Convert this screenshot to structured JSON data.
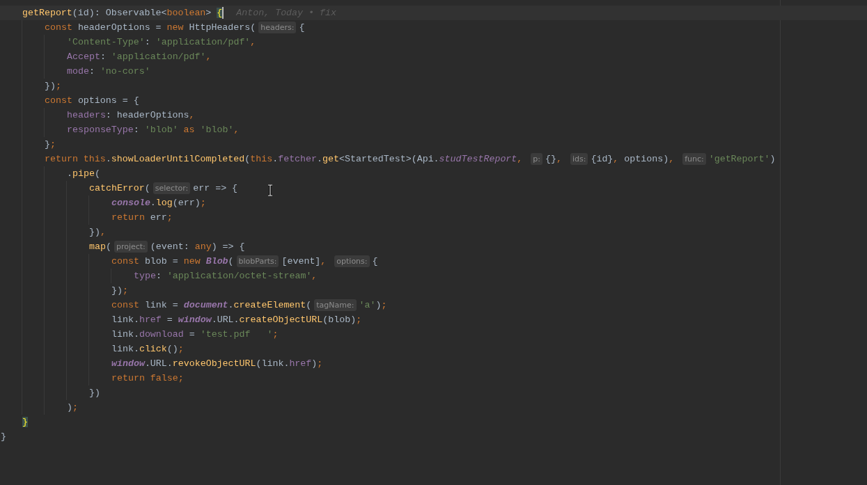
{
  "editor": {
    "lines": [
      {
        "current": true,
        "tokens": [
          {
            "kind": "fn",
            "text": "getReport"
          },
          {
            "kind": "plain",
            "text": "(id): Observable<"
          },
          {
            "kind": "kw",
            "text": "boolean"
          },
          {
            "kind": "plain",
            "text": "> "
          },
          {
            "kind": "match",
            "text": "{"
          },
          {
            "kind": "blame",
            "text": "Anton, Today • fix"
          }
        ],
        "children": [
          {
            "current": false,
            "tokens": [
              {
                "kind": "kw",
                "text": "const "
              },
              {
                "kind": "plain",
                "text": "headerOptions = "
              },
              {
                "kind": "kw",
                "text": "new "
              },
              {
                "kind": "plain",
                "text": "HttpHeaders("
              },
              {
                "kind": "hint",
                "text": "headers:"
              },
              {
                "kind": "plain",
                "text": "{"
              }
            ],
            "children": [
              {
                "current": false,
                "tokens": [
                  {
                    "kind": "str",
                    "text": "'Content-Type'"
                  },
                  {
                    "kind": "plain",
                    "text": ": "
                  },
                  {
                    "kind": "str",
                    "text": "'application/pdf'"
                  },
                  {
                    "kind": "punct",
                    "text": ","
                  }
                ]
              },
              {
                "current": false,
                "tokens": [
                  {
                    "kind": "prop",
                    "text": "Accept"
                  },
                  {
                    "kind": "plain",
                    "text": ": "
                  },
                  {
                    "kind": "str",
                    "text": "'application/pdf'"
                  },
                  {
                    "kind": "punct",
                    "text": ","
                  }
                ]
              },
              {
                "current": false,
                "tokens": [
                  {
                    "kind": "prop",
                    "text": "mode"
                  },
                  {
                    "kind": "plain",
                    "text": ": "
                  },
                  {
                    "kind": "str",
                    "text": "'no-cors'"
                  }
                ]
              }
            ]
          },
          {
            "current": false,
            "tokens": [
              {
                "kind": "plain",
                "text": "})"
              },
              {
                "kind": "punct",
                "text": ";"
              }
            ]
          },
          {
            "current": false,
            "tokens": [
              {
                "kind": "kw",
                "text": "const "
              },
              {
                "kind": "plain",
                "text": "options = {"
              }
            ],
            "children": [
              {
                "current": false,
                "tokens": [
                  {
                    "kind": "prop",
                    "text": "headers"
                  },
                  {
                    "kind": "plain",
                    "text": ": headerOptions"
                  },
                  {
                    "kind": "punct",
                    "text": ","
                  }
                ]
              },
              {
                "current": false,
                "tokens": [
                  {
                    "kind": "prop",
                    "text": "responseType"
                  },
                  {
                    "kind": "plain",
                    "text": ": "
                  },
                  {
                    "kind": "str",
                    "text": "'blob'"
                  },
                  {
                    "kind": "kw",
                    "text": " as "
                  },
                  {
                    "kind": "str",
                    "text": "'blob'"
                  },
                  {
                    "kind": "punct",
                    "text": ","
                  }
                ]
              }
            ]
          },
          {
            "current": false,
            "tokens": [
              {
                "kind": "plain",
                "text": "}"
              },
              {
                "kind": "punct",
                "text": ";"
              }
            ]
          },
          {
            "current": false,
            "tokens": [
              {
                "kind": "kw",
                "text": "return this"
              },
              {
                "kind": "plain",
                "text": "."
              },
              {
                "kind": "fn",
                "text": "showLoaderUntilCompleted"
              },
              {
                "kind": "plain",
                "text": "("
              },
              {
                "kind": "kw",
                "text": "this"
              },
              {
                "kind": "plain",
                "text": "."
              },
              {
                "kind": "prop",
                "text": "fetcher"
              },
              {
                "kind": "plain",
                "text": "."
              },
              {
                "kind": "fn",
                "text": "get"
              },
              {
                "kind": "plain",
                "text": "<StartedTest>(Api."
              },
              {
                "kind": "static",
                "text": "studTestReport"
              },
              {
                "kind": "punct",
                "text": ", "
              },
              {
                "kind": "hint",
                "text": "p:"
              },
              {
                "kind": "plain",
                "text": "{}"
              },
              {
                "kind": "punct",
                "text": ", "
              },
              {
                "kind": "hint",
                "text": "ids:"
              },
              {
                "kind": "plain",
                "text": "{id}"
              },
              {
                "kind": "punct",
                "text": ", "
              },
              {
                "kind": "plain",
                "text": "options)"
              },
              {
                "kind": "punct",
                "text": ", "
              },
              {
                "kind": "hint",
                "text": "func:"
              },
              {
                "kind": "str",
                "text": "'getReport'"
              },
              {
                "kind": "plain",
                "text": ")"
              }
            ],
            "children": [
              {
                "current": false,
                "tokens": [
                  {
                    "kind": "plain",
                    "text": "."
                  },
                  {
                    "kind": "fn",
                    "text": "pipe"
                  },
                  {
                    "kind": "plain",
                    "text": "("
                  }
                ],
                "children": [
                  {
                    "current": false,
                    "tokens": [
                      {
                        "kind": "fn",
                        "text": "catchError"
                      },
                      {
                        "kind": "plain",
                        "text": "("
                      },
                      {
                        "kind": "hint",
                        "text": "selector:"
                      },
                      {
                        "kind": "plain",
                        "text": "err => {"
                      }
                    ],
                    "children": [
                      {
                        "current": false,
                        "tokens": [
                          {
                            "kind": "global",
                            "text": "console"
                          },
                          {
                            "kind": "plain",
                            "text": "."
                          },
                          {
                            "kind": "fn",
                            "text": "log"
                          },
                          {
                            "kind": "plain",
                            "text": "(err)"
                          },
                          {
                            "kind": "punct",
                            "text": ";"
                          }
                        ]
                      },
                      {
                        "current": false,
                        "tokens": [
                          {
                            "kind": "kw",
                            "text": "return "
                          },
                          {
                            "kind": "plain",
                            "text": "err"
                          },
                          {
                            "kind": "punct",
                            "text": ";"
                          }
                        ]
                      }
                    ]
                  },
                  {
                    "current": false,
                    "tokens": [
                      {
                        "kind": "plain",
                        "text": "})"
                      },
                      {
                        "kind": "punct",
                        "text": ","
                      }
                    ]
                  },
                  {
                    "current": false,
                    "tokens": [
                      {
                        "kind": "fn",
                        "text": "map"
                      },
                      {
                        "kind": "plain",
                        "text": "("
                      },
                      {
                        "kind": "hint",
                        "text": "project:"
                      },
                      {
                        "kind": "plain",
                        "text": "(event: "
                      },
                      {
                        "kind": "kw",
                        "text": "any"
                      },
                      {
                        "kind": "plain",
                        "text": ") => {"
                      }
                    ],
                    "children": [
                      {
                        "current": false,
                        "tokens": [
                          {
                            "kind": "kw",
                            "text": "const "
                          },
                          {
                            "kind": "plain",
                            "text": "blob = "
                          },
                          {
                            "kind": "kw",
                            "text": "new "
                          },
                          {
                            "kind": "global",
                            "text": "Blob"
                          },
                          {
                            "kind": "plain",
                            "text": "("
                          },
                          {
                            "kind": "hint",
                            "text": "blobParts:"
                          },
                          {
                            "kind": "plain",
                            "text": "[event]"
                          },
                          {
                            "kind": "punct",
                            "text": ", "
                          },
                          {
                            "kind": "hint",
                            "text": "options:"
                          },
                          {
                            "kind": "plain",
                            "text": "{"
                          }
                        ],
                        "children": [
                          {
                            "current": false,
                            "tokens": [
                              {
                                "kind": "prop",
                                "text": "type"
                              },
                              {
                                "kind": "plain",
                                "text": ": "
                              },
                              {
                                "kind": "str",
                                "text": "'application/octet-stream'"
                              },
                              {
                                "kind": "punct",
                                "text": ","
                              }
                            ]
                          }
                        ]
                      },
                      {
                        "current": false,
                        "tokens": [
                          {
                            "kind": "plain",
                            "text": "})"
                          },
                          {
                            "kind": "punct",
                            "text": ";"
                          }
                        ]
                      },
                      {
                        "current": false,
                        "tokens": [
                          {
                            "kind": "kw",
                            "text": "const "
                          },
                          {
                            "kind": "plain",
                            "text": "link = "
                          },
                          {
                            "kind": "global",
                            "text": "document"
                          },
                          {
                            "kind": "plain",
                            "text": "."
                          },
                          {
                            "kind": "fn",
                            "text": "createElement"
                          },
                          {
                            "kind": "plain",
                            "text": "("
                          },
                          {
                            "kind": "hint",
                            "text": "tagName:"
                          },
                          {
                            "kind": "str",
                            "text": "'a'"
                          },
                          {
                            "kind": "plain",
                            "text": ")"
                          },
                          {
                            "kind": "punct",
                            "text": ";"
                          }
                        ]
                      },
                      {
                        "current": false,
                        "tokens": [
                          {
                            "kind": "plain",
                            "text": "link."
                          },
                          {
                            "kind": "prop",
                            "text": "href"
                          },
                          {
                            "kind": "plain",
                            "text": " = "
                          },
                          {
                            "kind": "global",
                            "text": "window"
                          },
                          {
                            "kind": "plain",
                            "text": ".URL."
                          },
                          {
                            "kind": "fn",
                            "text": "createObjectURL"
                          },
                          {
                            "kind": "plain",
                            "text": "(blob)"
                          },
                          {
                            "kind": "punct",
                            "text": ";"
                          }
                        ]
                      },
                      {
                        "current": false,
                        "tokens": [
                          {
                            "kind": "plain",
                            "text": "link."
                          },
                          {
                            "kind": "prop",
                            "text": "download"
                          },
                          {
                            "kind": "plain",
                            "text": " = "
                          },
                          {
                            "kind": "str",
                            "text": "'test.pdf   '"
                          },
                          {
                            "kind": "punct",
                            "text": ";"
                          }
                        ]
                      },
                      {
                        "current": false,
                        "tokens": [
                          {
                            "kind": "plain",
                            "text": "link."
                          },
                          {
                            "kind": "fn",
                            "text": "click"
                          },
                          {
                            "kind": "plain",
                            "text": "()"
                          },
                          {
                            "kind": "punct",
                            "text": ";"
                          }
                        ]
                      },
                      {
                        "current": false,
                        "tokens": [
                          {
                            "kind": "global",
                            "text": "window"
                          },
                          {
                            "kind": "plain",
                            "text": ".URL."
                          },
                          {
                            "kind": "fn",
                            "text": "revokeObjectURL"
                          },
                          {
                            "kind": "plain",
                            "text": "(link."
                          },
                          {
                            "kind": "prop",
                            "text": "href"
                          },
                          {
                            "kind": "plain",
                            "text": ")"
                          },
                          {
                            "kind": "punct",
                            "text": ";"
                          }
                        ]
                      },
                      {
                        "current": false,
                        "tokens": [
                          {
                            "kind": "kw",
                            "text": "return false"
                          },
                          {
                            "kind": "punct",
                            "text": ";"
                          }
                        ]
                      }
                    ]
                  },
                  {
                    "current": false,
                    "tokens": [
                      {
                        "kind": "plain",
                        "text": "})"
                      }
                    ]
                  }
                ]
              },
              {
                "current": false,
                "tokens": [
                  {
                    "kind": "plain",
                    "text": ")"
                  },
                  {
                    "kind": "punct",
                    "text": ";"
                  }
                ]
              }
            ]
          }
        ]
      },
      {
        "current": false,
        "tokens": [
          {
            "kind": "match",
            "text": "}"
          }
        ]
      }
    ],
    "closing_line": {
      "tokens": [
        {
          "kind": "plain",
          "text": "}"
        }
      ]
    }
  }
}
